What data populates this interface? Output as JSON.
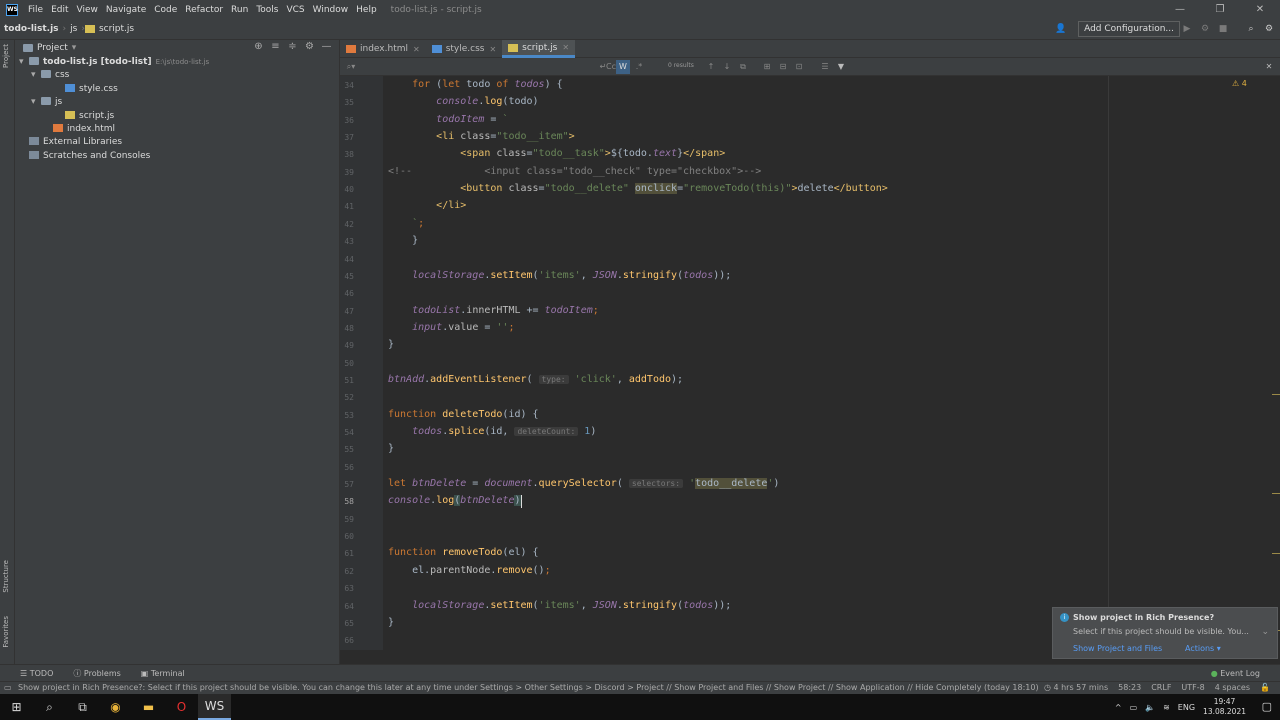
{
  "menubar": {
    "items": [
      "File",
      "Edit",
      "View",
      "Navigate",
      "Code",
      "Refactor",
      "Run",
      "Tools",
      "VCS",
      "Window",
      "Help"
    ],
    "title": "todo-list.js - script.js"
  },
  "navbar": {
    "crumbs": [
      "todo-list.js",
      "js",
      "script.js"
    ],
    "add_configuration": "Add Configuration..."
  },
  "left_strip": {
    "project": "Project",
    "structure": "Structure",
    "favorites": "Favorites"
  },
  "project_panel": {
    "title": "Project",
    "tree": [
      {
        "label": "todo-list.js [todo-list]",
        "hint": "E:\\js\\todo-list.js",
        "indent": 0,
        "icon": "folder",
        "chev": "▾"
      },
      {
        "label": "css",
        "hint": "",
        "indent": 1,
        "icon": "folder",
        "chev": "▾"
      },
      {
        "label": "style.css",
        "hint": "",
        "indent": 3,
        "icon": "css",
        "chev": ""
      },
      {
        "label": "js",
        "hint": "",
        "indent": 1,
        "icon": "folder",
        "chev": "▾"
      },
      {
        "label": "script.js",
        "hint": "",
        "indent": 3,
        "icon": "js",
        "chev": ""
      },
      {
        "label": "index.html",
        "hint": "",
        "indent": 2,
        "icon": "html",
        "chev": ""
      },
      {
        "label": "External Libraries",
        "hint": "",
        "indent": 0,
        "icon": "lib",
        "chev": ""
      },
      {
        "label": "Scratches and Consoles",
        "hint": "",
        "indent": 0,
        "icon": "lib",
        "chev": ""
      }
    ]
  },
  "tabs": [
    {
      "label": "index.html",
      "icon": "html",
      "active": false
    },
    {
      "label": "style.css",
      "icon": "css",
      "active": false
    },
    {
      "label": "script.js",
      "icon": "js",
      "active": true
    }
  ],
  "findbar": {
    "results": "0 results",
    "cc": "Cc",
    "w": "W"
  },
  "editor": {
    "first_line": 34,
    "current_line": 58,
    "warnings": "4",
    "lines": [
      "    <k>for</k> (<k>let</k> todo <k>of</k> <i>todos</i>) {",
      "        <i>console</i>.<m>log</m>(todo)",
      "        <i>todoItem</i> = <s>`</s>",
      "        <t>&lt;li</t> <a>class</a>=<s>\"todo__item\"</s><t>&gt;</t>",
      "            <t>&lt;span</t> <a>class</a>=<s>\"todo__task\"</s><t>&gt;</t>${todo.<i>text</i>}<t>&lt;/span&gt;</t>",
      "<c>&lt;!--            &lt;input class=\"todo__check\" type=\"checkbox\"&gt;--&gt;</c>",
      "            <t>&lt;button</t> <a>class</a>=<s>\"todo__delete\"</s> <g>onclick</g>=<s>\"removeTodo(this)\"</s><t>&gt;</t>delete<t>&lt;/button&gt;</t>",
      "        <t>&lt;/li&gt;</t>",
      "    <s>`</s><k>;</k>",
      "    }",
      "",
      "    <i>localStorage</i>.<m>setItem</m>(<s>'items'</s>, <i>JSON</i>.<m>stringify</m>(<i>todos</i>));",
      "",
      "    <i>todoList</i>.<a>innerHTML</a> += <i>todoItem</i><k>;</k>",
      "    <i>input</i>.<a>value</a> = <s>''</s><k>;</k>",
      "}",
      "",
      "<i>btnAdd</i>.<m>addEventListener</m>( <h>type:</h> <s>'click'</s>, <m>addTodo</m>);",
      "",
      "<k>function</k> <n>deleteTodo</n>(id) {",
      "    <i>todos</i>.<m>splice</m>(id, <h>deleteCount:</h> <b>1</b>)",
      "}",
      "",
      "<k>let</k> <i>btnDelete</i> = <i>document</i>.<m>querySelector</m>( <h>selectors:</h> <s>'</s><y>todo__delete</y><s>'</s>)",
      "<i>console</i>.<m>log</m><p>(</p><i>btnDelete</i><p>)</p>",
      "",
      "",
      "<k>function</k> <n>removeTodo</n>(el) {",
      "    el.<a>parentNode</a>.<m>remove</m>()<k>;</k>",
      "",
      "    <i>localStorage</i>.<m>setItem</m>(<s>'items'</s>, <i>JSON</i>.<m>stringify</m>(<i>todos</i>));",
      "}",
      ""
    ]
  },
  "toolwindows": {
    "todo": "TODO",
    "problems": "Problems",
    "terminal": "Terminal",
    "event_log": "Event Log"
  },
  "notification": {
    "title": "Show project in Rich Presence?",
    "body": "Select if this project should be visible. You...",
    "action1": "Show Project and Files",
    "action2": "Actions ▾"
  },
  "statusbar": {
    "message": "Show project in Rich Presence?: Select if this project should be visible. You can change this later at any time under Settings > Other Settings > Discord > Project // Show Project and Files // Show Project // Show Application // Hide Completely (today 18:10)",
    "time_spent": "4 hrs 57 mins",
    "position": "58:23",
    "line_sep": "CRLF",
    "encoding": "UTF-8",
    "indent": "4 spaces"
  },
  "taskbar": {
    "lang": "ENG",
    "time": "19:47",
    "date": "13.08.2021"
  }
}
